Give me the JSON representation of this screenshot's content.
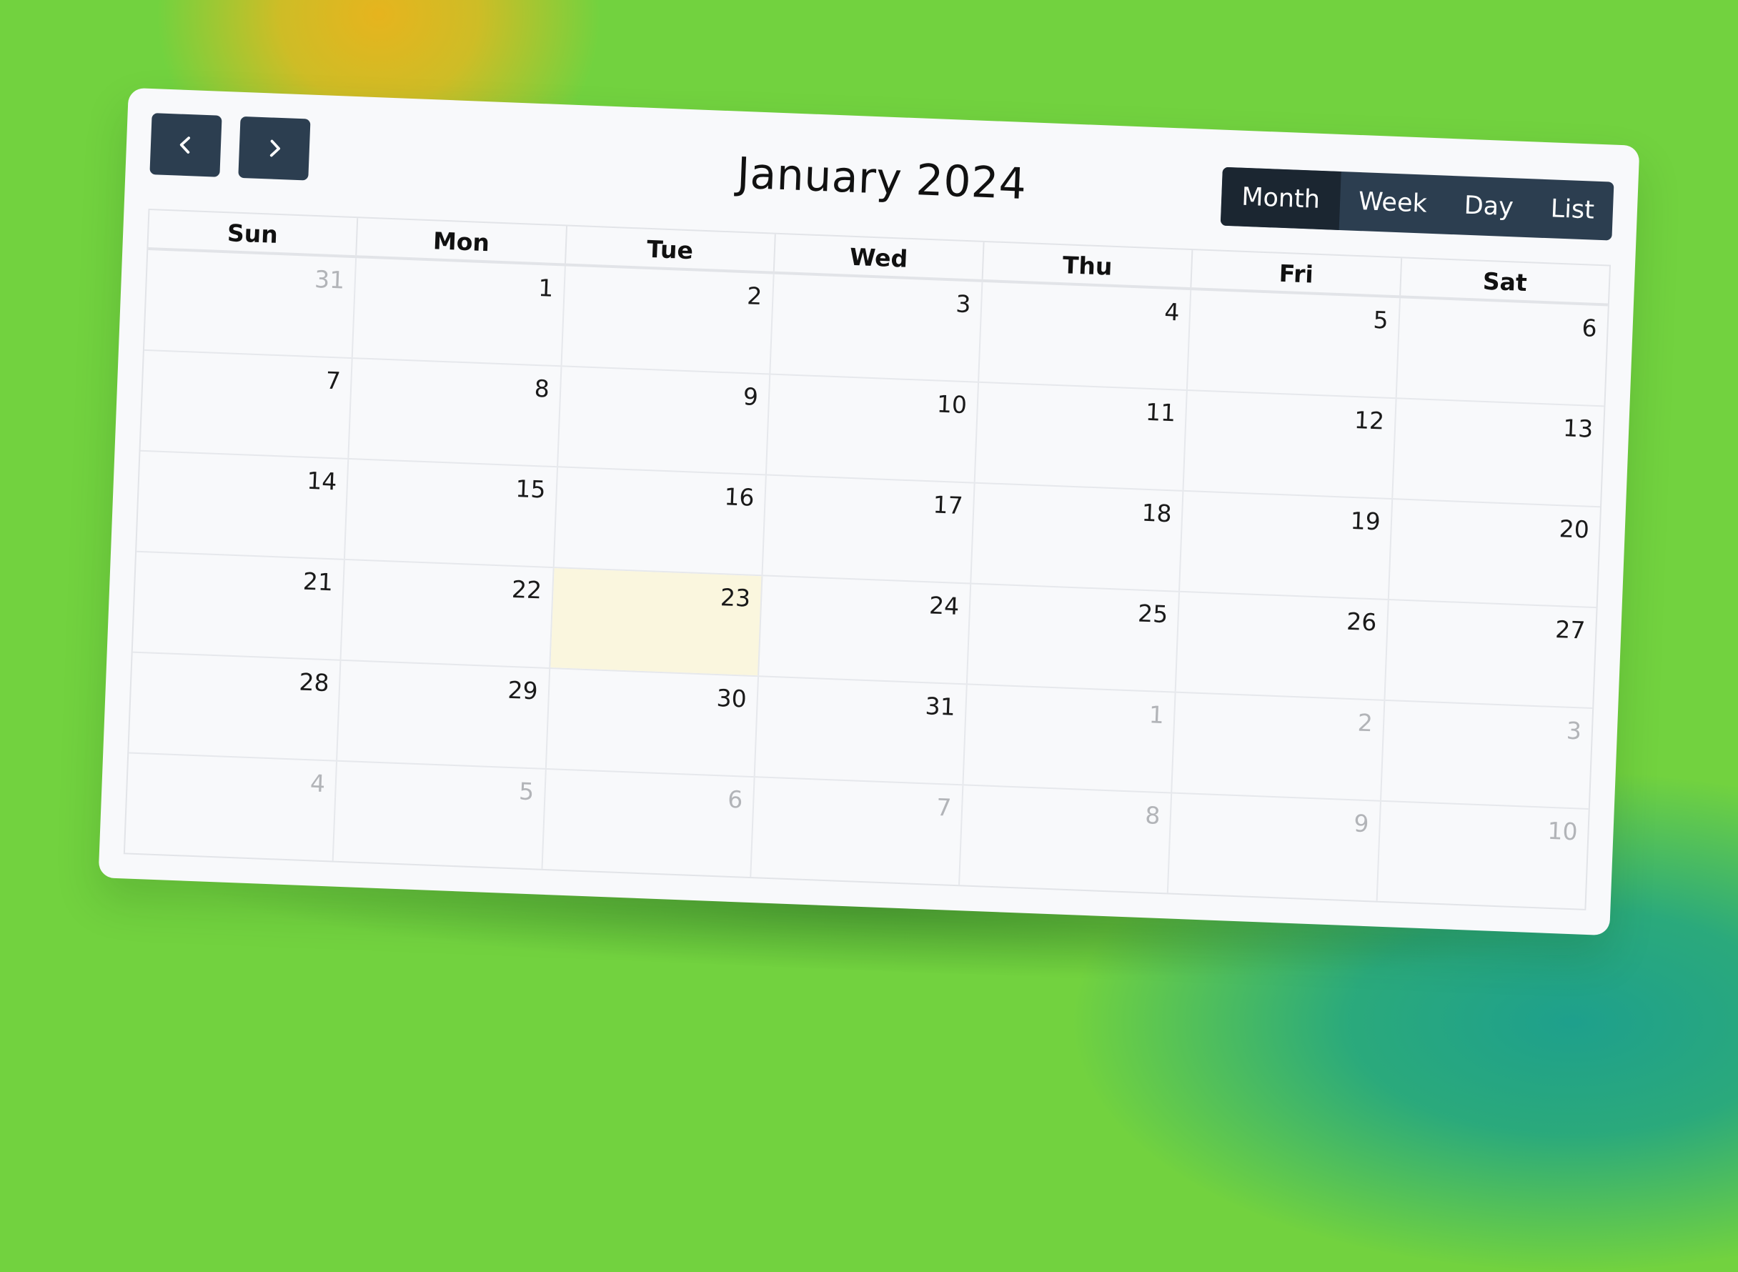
{
  "header": {
    "title": "January 2024",
    "prev_label": "Previous month",
    "next_label": "Next month"
  },
  "views": [
    {
      "label": "Month",
      "active": true
    },
    {
      "label": "Week",
      "active": false
    },
    {
      "label": "Day",
      "active": false
    },
    {
      "label": "List",
      "active": false
    }
  ],
  "weekdays": [
    "Sun",
    "Mon",
    "Tue",
    "Wed",
    "Thu",
    "Fri",
    "Sat"
  ],
  "weeks": [
    [
      {
        "d": "31",
        "other": true
      },
      {
        "d": "1"
      },
      {
        "d": "2"
      },
      {
        "d": "3"
      },
      {
        "d": "4"
      },
      {
        "d": "5"
      },
      {
        "d": "6"
      }
    ],
    [
      {
        "d": "7"
      },
      {
        "d": "8"
      },
      {
        "d": "9"
      },
      {
        "d": "10"
      },
      {
        "d": "11"
      },
      {
        "d": "12"
      },
      {
        "d": "13"
      }
    ],
    [
      {
        "d": "14"
      },
      {
        "d": "15"
      },
      {
        "d": "16"
      },
      {
        "d": "17"
      },
      {
        "d": "18"
      },
      {
        "d": "19"
      },
      {
        "d": "20"
      }
    ],
    [
      {
        "d": "21"
      },
      {
        "d": "22"
      },
      {
        "d": "23",
        "today": true
      },
      {
        "d": "24"
      },
      {
        "d": "25"
      },
      {
        "d": "26"
      },
      {
        "d": "27"
      }
    ],
    [
      {
        "d": "28"
      },
      {
        "d": "29"
      },
      {
        "d": "30"
      },
      {
        "d": "31"
      },
      {
        "d": "1",
        "other": true
      },
      {
        "d": "2",
        "other": true
      },
      {
        "d": "3",
        "other": true
      }
    ],
    [
      {
        "d": "4",
        "other": true
      },
      {
        "d": "5",
        "other": true
      },
      {
        "d": "6",
        "other": true
      },
      {
        "d": "7",
        "other": true
      },
      {
        "d": "8",
        "other": true
      },
      {
        "d": "9",
        "other": true
      },
      {
        "d": "10",
        "other": true
      }
    ]
  ],
  "colors": {
    "button_bg": "#2c3e50",
    "active_view_bg": "#1b2631",
    "today_bg": "#faf6de",
    "other_month_text": "#b2b4b8",
    "background": "#72d23f"
  }
}
